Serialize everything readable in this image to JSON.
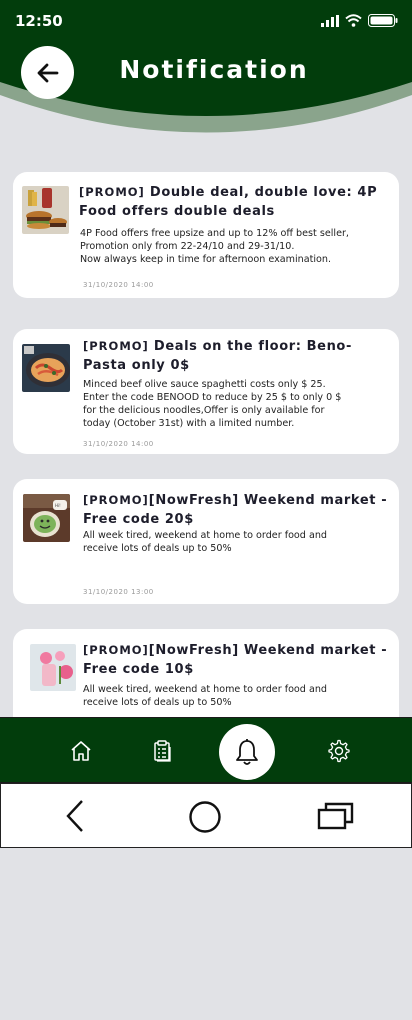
{
  "status_bar": {
    "time": "12:50"
  },
  "header": {
    "title": "Notification"
  },
  "colors": {
    "primary": "#023d0c",
    "background": "#e1e2e6",
    "card": "#ffffff"
  },
  "notifications": [
    {
      "tag": "[PROMO]",
      "title": " Double deal, double love: 4P Food offers double deals",
      "body": "4P Food offers free upsize and up to 12% off best seller,\nPromotion only from 22-24/10 and 29-31/10.\nNow always keep in time for afternoon examination.",
      "time": "31/10/2020  14:00",
      "thumbnail": "burger-combo-image"
    },
    {
      "tag": "[PROMO]",
      "title": " Deals on the floor: Beno-Pasta only 0$",
      "body": "Minced beef olive sauce spaghetti costs only $ 25.\nEnter the code BENOOD to reduce by 25 $ to only 0 $\nfor the delicious noodles,Offer is only available for\ntoday (October 31st) with a limited number.",
      "time": "31/10/2020  14:00",
      "thumbnail": "pasta-plate-image"
    },
    {
      "tag": "[PROMO]",
      "title": "[NowFresh] Weekend market - Free code 20$",
      "body": "All week tired, weekend at home to order food and\nreceive lots of deals up to 50%",
      "time": "31/10/2020  13:00",
      "thumbnail": "latte-art-image"
    },
    {
      "tag": "[PROMO]",
      "title": "[NowFresh] Weekend market - Free code 10$",
      "body": "All week tired, weekend at home to order food and\nreceive lots of deals up to 50%",
      "time": "",
      "thumbnail": "flower-drink-image"
    }
  ],
  "bottom_nav": [
    {
      "name": "home-icon",
      "active": false
    },
    {
      "name": "clipboard-list-icon",
      "active": false
    },
    {
      "name": "bell-icon",
      "active": true
    },
    {
      "name": "gear-icon",
      "active": false
    }
  ],
  "system_nav": [
    "back-icon",
    "home-circle-icon",
    "recent-apps-icon"
  ]
}
